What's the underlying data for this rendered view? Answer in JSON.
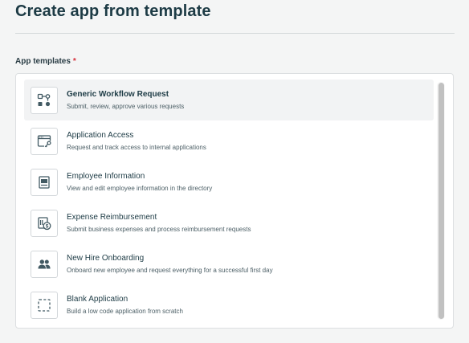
{
  "page": {
    "title": "Create app from template"
  },
  "field": {
    "label": "App templates",
    "required_marker": "*"
  },
  "templates": [
    {
      "title": "Generic Workflow Request",
      "description": "Submit, review, approve various requests",
      "icon": "workflow-icon",
      "selected": true
    },
    {
      "title": "Application Access",
      "description": "Request and track access to internal applications",
      "icon": "app-access-icon",
      "selected": false
    },
    {
      "title": "Employee Information",
      "description": "View and edit employee information in the directory",
      "icon": "employee-info-icon",
      "selected": false
    },
    {
      "title": "Expense Reimbursement",
      "description": "Submit business expenses and process reimbursement requests",
      "icon": "expense-icon",
      "selected": false
    },
    {
      "title": "New Hire Onboarding",
      "description": "Onboard new employee and request everything for a successful first day",
      "icon": "people-icon",
      "selected": false
    },
    {
      "title": "Blank Application",
      "description": "Build a low code application from scratch",
      "icon": "blank-icon",
      "selected": false
    }
  ],
  "colors": {
    "title_text": "#1d3b45",
    "required": "#d62f3b",
    "selected_bg": "#f2f3f4",
    "icon_stroke": "#425a63"
  }
}
